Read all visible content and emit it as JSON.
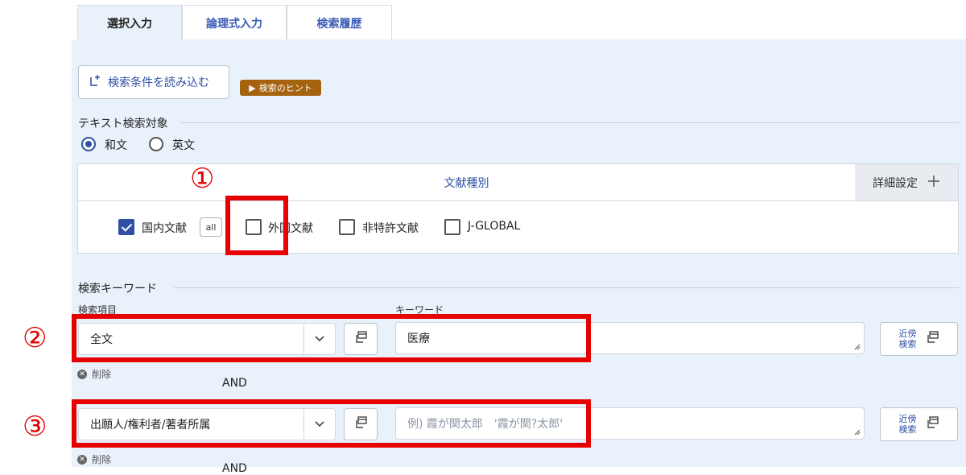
{
  "tabs": [
    {
      "label": "選択入力",
      "active": true
    },
    {
      "label": "論理式入力",
      "active": false
    },
    {
      "label": "検索履歴",
      "active": false
    }
  ],
  "toolbar": {
    "load_label": "検索条件を読み込む",
    "hint_label": "検索のヒント"
  },
  "text_target": {
    "title": "テキスト検索対象",
    "options": [
      {
        "label": "和文",
        "selected": true
      },
      {
        "label": "英文",
        "selected": false
      }
    ]
  },
  "doc_types": {
    "title": "文献種別",
    "detail_label": "詳細設定",
    "all_label": "all",
    "items": [
      {
        "label": "国内文献",
        "checked": true
      },
      {
        "label": "外国文献",
        "checked": false
      },
      {
        "label": "非特許文献",
        "checked": false
      },
      {
        "label": "J-GLOBAL",
        "checked": false
      }
    ]
  },
  "keywords": {
    "title": "検索キーワード",
    "field_header": "検索項目",
    "keyword_header": "キーワード",
    "operator": "AND",
    "delete_label": "削除",
    "near_label_1": "近傍",
    "near_label_2": "検索",
    "rows": [
      {
        "field": "全文",
        "value": "医療",
        "placeholder": ""
      },
      {
        "field": "出願人/権利者/著者所属",
        "value": "",
        "placeholder": "例) 霞が関太郎　'霞が関?太郎'"
      }
    ]
  },
  "annotations": {
    "one": "①",
    "two": "②",
    "three": "③"
  },
  "colors": {
    "accent": "#2e4fa3",
    "panel_bg": "#e9f1fa",
    "highlight": "#e60000",
    "hint_bg": "#a5620f"
  }
}
